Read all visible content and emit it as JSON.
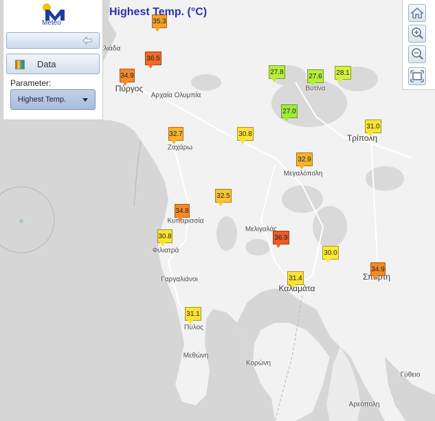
{
  "app": {
    "logo_text": "Meteo",
    "title": "Highest Temp. (°C)",
    "accent_color": "#2d2fae"
  },
  "panel": {
    "data_button_label": "Data",
    "data_icon": "color-palette-icon",
    "collapse_icon": "collapse-arrow-icon",
    "parameter_label": "Parameter:",
    "parameter_value": "Highest Temp."
  },
  "toolbar": {
    "home_icon": "home-icon",
    "zoom_in_icon": "zoom-in-icon",
    "zoom_out_icon": "zoom-out-icon",
    "full_extent_icon": "full-extent-icon"
  },
  "places": [
    {
      "name": "Πύργος"
    },
    {
      "name": "Αρχαία Ολυμπία"
    },
    {
      "name": "Ζαχάρω"
    },
    {
      "name": "Βυτίνα"
    },
    {
      "name": "Τρίπολη"
    },
    {
      "name": "Μεγαλόπολη"
    },
    {
      "name": "Κυπαρισσία"
    },
    {
      "name": "Μελιγαλάς"
    },
    {
      "name": "Φιλιατρά"
    },
    {
      "name": "Γαργαλιάνοι"
    },
    {
      "name": "Καλαμάτα"
    },
    {
      "name": "Σπάρτη"
    },
    {
      "name": "Πύλος"
    },
    {
      "name": "Μεθώνη"
    },
    {
      "name": "Κορώνη"
    },
    {
      "name": "Γύθειο"
    },
    {
      "name": "Αρεόπολη"
    },
    {
      "name": "Αμαλιάδα"
    }
  ],
  "stations": [
    {
      "value": "35.3",
      "color": "#f4a028"
    },
    {
      "value": "36.5",
      "color": "#f06a28"
    },
    {
      "value": "34.9",
      "color": "#f58a26"
    },
    {
      "value": "27.8",
      "color": "#b6ee3a"
    },
    {
      "value": "27.6",
      "color": "#b6ee3a"
    },
    {
      "value": "28.1",
      "color": "#d4f23e"
    },
    {
      "value": "27.0",
      "color": "#9cec38"
    },
    {
      "value": "32.7",
      "color": "#f7b22a"
    },
    {
      "value": "30.8",
      "color": "#fce333"
    },
    {
      "value": "31.0",
      "color": "#fce333"
    },
    {
      "value": "32.9",
      "color": "#f7b22a"
    },
    {
      "value": "32.5",
      "color": "#f9c42f"
    },
    {
      "value": "34.8",
      "color": "#f58a26"
    },
    {
      "value": "30.8",
      "color": "#fce333"
    },
    {
      "value": "36.9",
      "color": "#ee5a25"
    },
    {
      "value": "30.0",
      "color": "#fdeb36"
    },
    {
      "value": "31.4",
      "color": "#fce333"
    },
    {
      "value": "34.9",
      "color": "#f58a26"
    },
    {
      "value": "31.1",
      "color": "#fce333"
    }
  ]
}
